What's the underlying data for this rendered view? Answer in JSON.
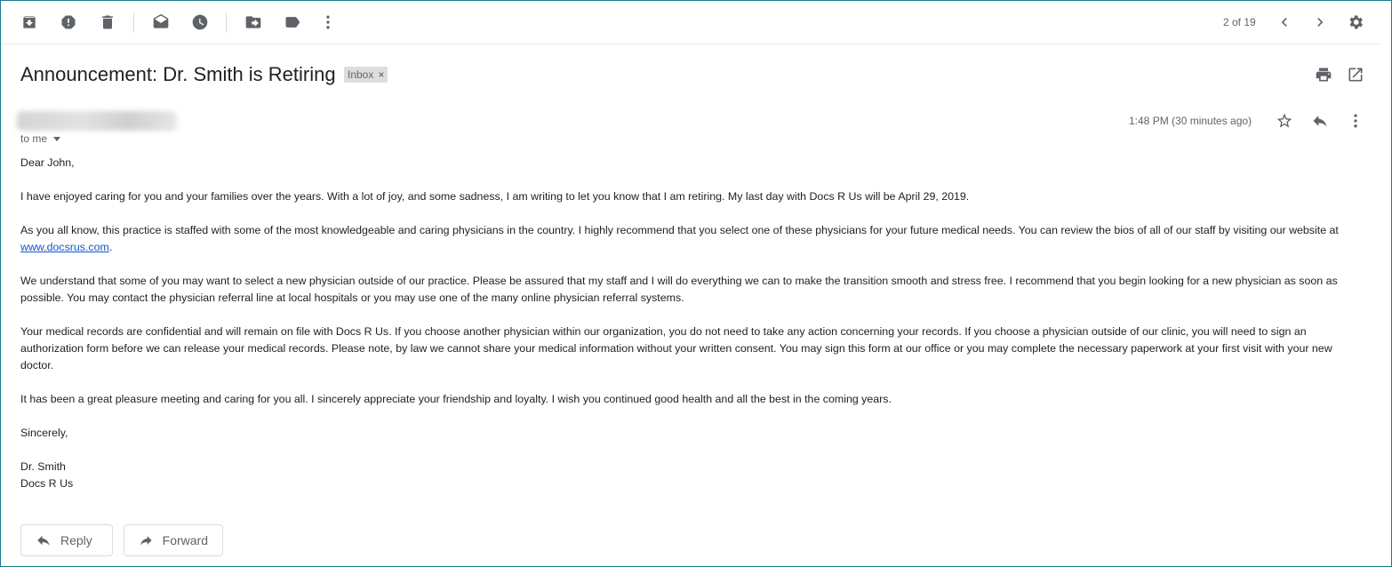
{
  "toolbar": {
    "icons": [
      "archive-icon",
      "report-spam-icon",
      "delete-icon",
      "mark-unread-icon",
      "snooze-icon",
      "move-to-icon",
      "label-icon",
      "more-icon"
    ],
    "pager": "2 of 19",
    "nav": [
      "older-icon",
      "newer-icon"
    ],
    "settings": "settings-icon"
  },
  "email": {
    "subject": "Announcement: Dr. Smith is Retiring",
    "label": "Inbox",
    "label_remove": "×",
    "recipient": "to me",
    "time": "1:48 PM (30 minutes ago)",
    "greeting": "Dear John,",
    "p1": "I have enjoyed caring for you and your families over the years. With a lot of joy, and some sadness, I am writing to let you know that I am retiring. My last day with Docs R Us will be April 29, 2019.",
    "p2_text": "As you all know, this practice is staffed with some of the most knowledgeable and caring physicians in the country. I highly recommend that you select one of these physicians for your future medical needs. You can review the bios of all of our staff by visiting our website at ",
    "p2_link": "www.docsrus.com",
    "p2_end": ".",
    "p3": "We understand that some of you may want to select a new physician outside of our practice. Please be assured that my staff and I will do everything we can to make the transition smooth and stress free. I recommend that you begin looking for a new physician as soon as possible. You may contact the physician referral line at local hospitals or you may use one of the many online physician referral systems.",
    "p4": "Your medical records are confidential and will remain on file with Docs R Us. If you choose another physician within our organization, you do not need to take any action concerning your records. If you choose a physician outside of our clinic, you will need to sign an authorization form before we can release your medical records. Please note, by law we cannot share your medical information without your written consent. You may sign this form at our office or you may complete the necessary paperwork at your first visit with your new doctor.",
    "p5": "It has been a great pleasure meeting and caring for you all. I sincerely appreciate your friendship and loyalty. I wish you continued good health and all the best in the coming years.",
    "closing": "Sincerely,",
    "sig_name": "Dr. Smith",
    "sig_org": "Docs R Us"
  },
  "actions": {
    "reply": "Reply",
    "forward": "Forward"
  }
}
